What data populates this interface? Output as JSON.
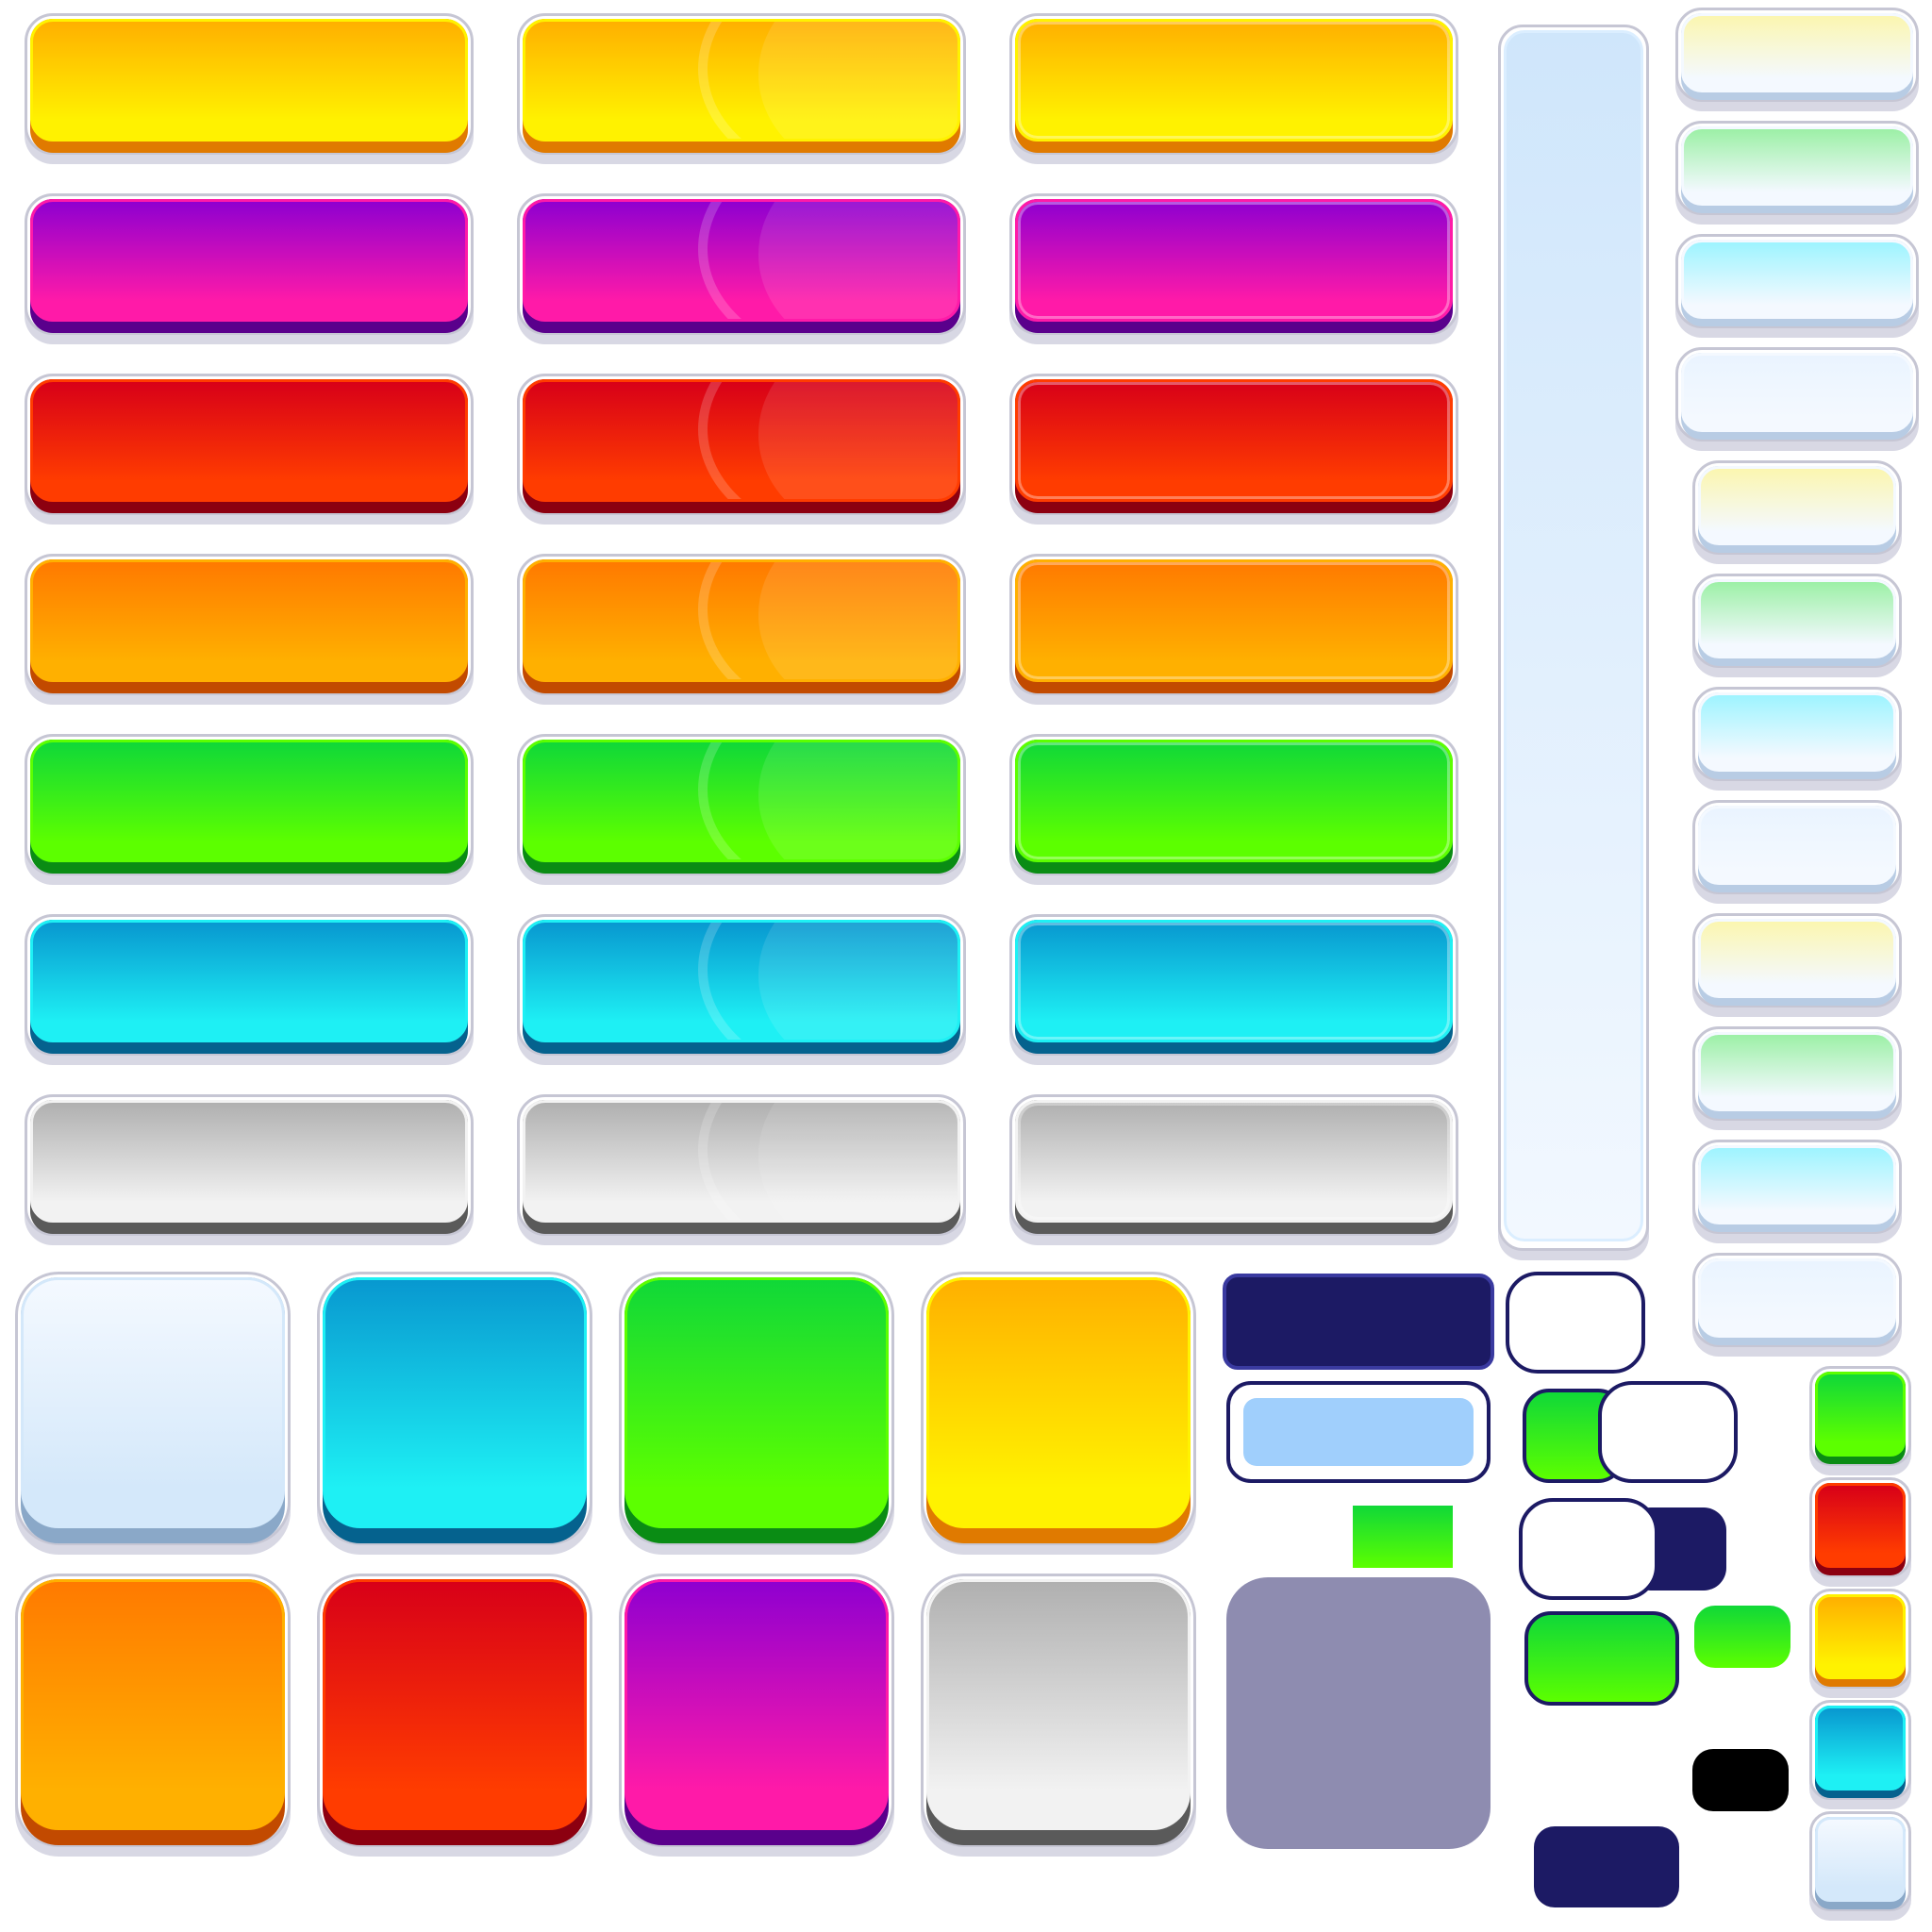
{
  "colors": {
    "yellow": [
      "#ffb000",
      "#fff200",
      "#e07a00"
    ],
    "magenta": [
      "#8f00d0",
      "#ff1aa8",
      "#5a008c"
    ],
    "red": [
      "#d80018",
      "#ff3c00",
      "#8c0010"
    ],
    "orange": [
      "#ff7a00",
      "#ffb000",
      "#c24a00"
    ],
    "green": [
      "#10d838",
      "#5cff00",
      "#0a8c14"
    ],
    "cyan": [
      "#0898d0",
      "#1ef0f4",
      "#05628e"
    ],
    "gray": [
      "#b0b0b0",
      "#f2f2f2",
      "#5a5a5a"
    ],
    "pale": [
      "#f4f9ff",
      "#d4e8fa",
      "#8aa8c8"
    ],
    "navy": "#1c1a64",
    "slate": "#8e8cb0",
    "lightblue": "#a0cffc",
    "black": "#000000"
  },
  "palette_rows": [
    "yellow",
    "magenta",
    "red",
    "orange",
    "green",
    "cyan",
    "gray"
  ],
  "side_tints": [
    "#fbf6b0",
    "#9cf0a6",
    "#9ef4ff",
    "#eaf4ff",
    "#fbf6b0",
    "#9cf0a6",
    "#9ef4ff",
    "#eaf4ff",
    "#fbf6b0",
    "#9cf0a6",
    "#9ef4ff",
    "#eaf4ff"
  ],
  "square_top": [
    "pale",
    "cyan",
    "green",
    "yellow"
  ],
  "square_bottom": [
    "orange",
    "red",
    "magenta",
    "gray"
  ],
  "small_squares": [
    "green",
    "red",
    "yellow",
    "cyan",
    "pale"
  ]
}
